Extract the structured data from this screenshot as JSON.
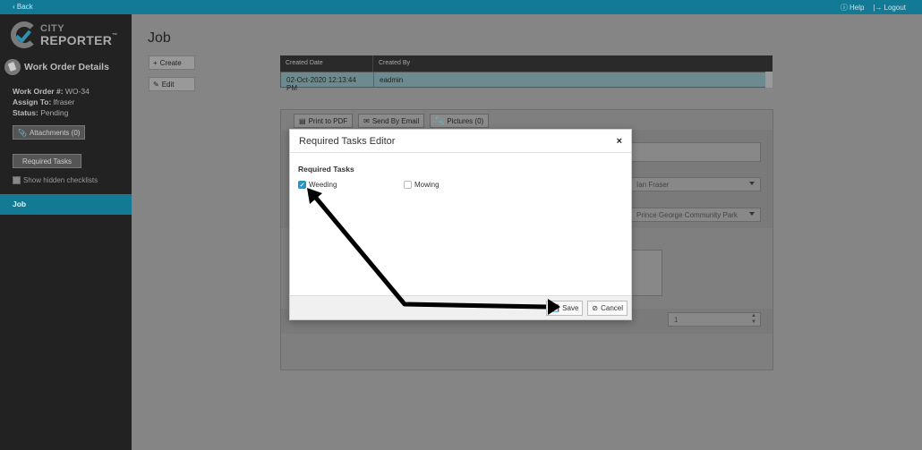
{
  "topbar": {
    "back_label": "Back",
    "help_label": "Help",
    "logout_label": "Logout"
  },
  "logo": {
    "line1": "CITY",
    "line2": "REPORTER",
    "tm": "™"
  },
  "sidebar": {
    "section_title": "Work Order Details",
    "work_order_key": "Work Order #:",
    "work_order_value": "WO-34",
    "assign_key": "Assign To:",
    "assign_value": "lfraser",
    "status_key": "Status:",
    "status_value": "Pending",
    "attachments_label": "Attachments (0)",
    "required_tasks_label": "Required Tasks",
    "hidden_checklists_label": "Show hidden checklists",
    "job_label": "Job"
  },
  "main": {
    "title": "Job",
    "create_label": "Create",
    "edit_label": "Edit",
    "grid": {
      "headers": [
        "Created Date",
        "Created By"
      ],
      "row": [
        "02-Oct-2020 12:13:44 PM",
        "eadmin"
      ]
    },
    "tabs": [
      "Print to PDF",
      "Send By Email",
      "Pictures (0)"
    ],
    "assignee_select": "Ian Fraser",
    "location_select": "Prince George Community Park",
    "quantity_value": "1"
  },
  "modal": {
    "title": "Required Tasks Editor",
    "close_glyph": "×",
    "section_label": "Required Tasks",
    "tasks": [
      {
        "label": "Weeding",
        "checked": true
      },
      {
        "label": "Mowing",
        "checked": false
      }
    ],
    "save_label": "Save",
    "cancel_label": "Cancel"
  },
  "colors": {
    "accent": "#127a94",
    "checkbox": "#2a93c6",
    "sidebar": "#222222"
  }
}
